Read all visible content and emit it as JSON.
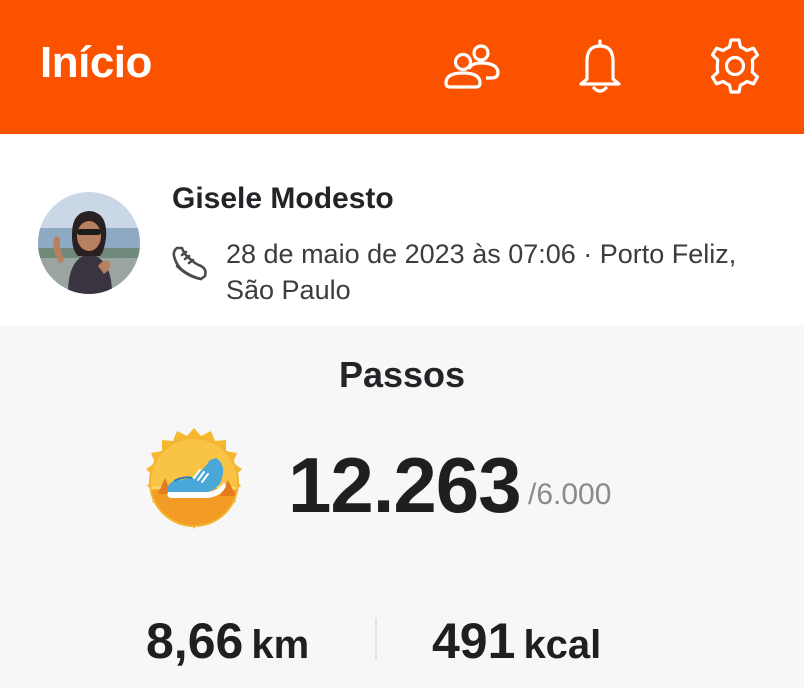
{
  "header": {
    "title": "Início",
    "icons": [
      "friends-icon",
      "bell-icon",
      "gear-icon"
    ],
    "color": "#fb5200"
  },
  "post": {
    "athlete_name": "Gisele Modesto",
    "activity_icon": "shoe-icon",
    "meta": "28 de maio de 2023 às 07:06 · Porto Feliz, São Paulo"
  },
  "steps": {
    "title": "Passos",
    "value": "12.263",
    "goal": "/6.000",
    "badge_icon": "sneaker-badge-icon"
  },
  "stats": {
    "distance_value": "8,66",
    "distance_unit": "km",
    "calories_value": "491",
    "calories_unit": "kcal"
  }
}
